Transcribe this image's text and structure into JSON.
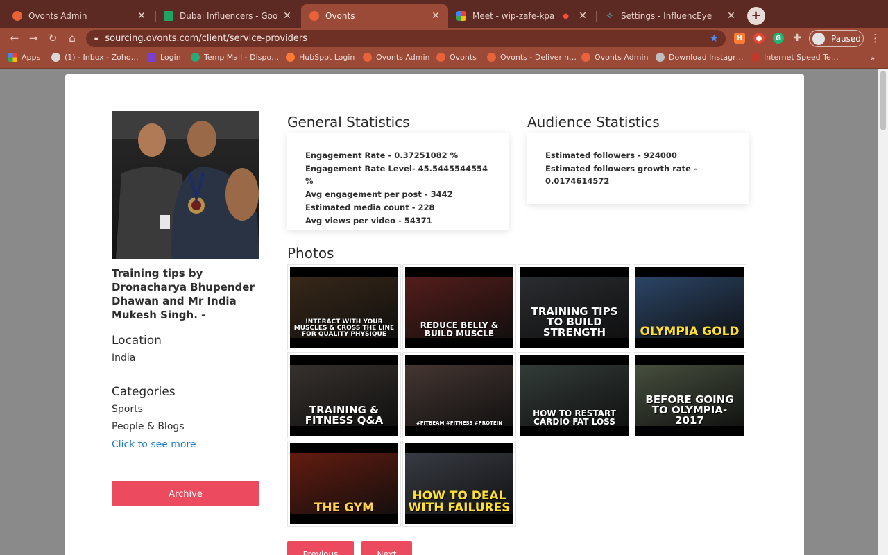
{
  "browser": {
    "tabs": [
      {
        "title": "Ovonts Admin",
        "active": false
      },
      {
        "title": "Dubai Influencers - Google Sh",
        "active": false
      },
      {
        "title": "Ovonts",
        "active": true
      },
      {
        "title": "Meet - wip-zafe-kpa",
        "active": false
      },
      {
        "title": "Settings - InfluencEye",
        "active": false
      }
    ],
    "new_tab": "+",
    "url": "sourcing.ovonts.com/client/service-providers",
    "profile_label": "Paused",
    "bookmarks": [
      "Apps",
      "(1) - Inbox - Zoho…",
      "Login",
      "Temp Mail - Dispo…",
      "HubSpot Login",
      "Ovonts Admin",
      "Ovonts",
      "Ovonts - Deliverin…",
      "Ovonts Admin",
      "Download Instagr…",
      "Internet Speed Te…"
    ],
    "bookmarks_more": "»"
  },
  "profile": {
    "name": "Training tips by Dronacharya Bhupender Dhawan and Mr India Mukesh Singh. -",
    "location_label": "Location",
    "location": "India",
    "categories_label": "Categories",
    "categories": [
      "Sports",
      "People & Blogs"
    ],
    "see_more": "Click to see more",
    "archive_label": "Archive"
  },
  "general_stats": {
    "title": "General Statistics",
    "lines": [
      "Engagement Rate - 0.37251082 %",
      "Engagement Rate Level- 45.5445544554 %",
      "Avg engagement per post - 3442",
      "Estimated media count - 228",
      "Avg views per video - 54371"
    ]
  },
  "audience_stats": {
    "title": "Audience Statistics",
    "lines": [
      "Estimated followers - 924000",
      "Estimated followers growth rate -",
      "0.0174614572"
    ]
  },
  "photos": {
    "title": "Photos",
    "items": [
      {
        "caption": "INTERACT WITH YOUR MUSCLES & CROSS THE LINE FOR QUALITY PHYSIQUE",
        "bg": "#3b2a1a"
      },
      {
        "caption": "REDUCE BELLY & BUILD MUSCLE",
        "bg": "#5a1f1c"
      },
      {
        "caption": "TRAINING TIPS TO BUILD STRENGTH",
        "bg": "#2d2f33"
      },
      {
        "caption": "OLYMPIA GOLD",
        "bg": "#2e4a6e"
      },
      {
        "caption": "TRAINING & FITNESS Q&A",
        "bg": "#3a3430"
      },
      {
        "caption": "#FITBEAM #FITNESS #PROTEIN",
        "bg": "#4a3a35"
      },
      {
        "caption": "HOW TO RESTART CARDIO FAT LOSS",
        "bg": "#36403c"
      },
      {
        "caption": "BEFORE GOING TO OLYMPIA-2017",
        "bg": "#4b5542"
      },
      {
        "caption": "THE GYM",
        "bg": "#6a1d10"
      },
      {
        "caption": "HOW TO DEAL WITH FAILURES",
        "bg": "#3c3f49"
      }
    ]
  },
  "pager": {
    "previous": "Previous",
    "next": "Next"
  },
  "colors": {
    "accent": "#ec4a5e",
    "link": "#1f7dc7",
    "chrome": "#9a4a37",
    "tabbar": "#5c2a22"
  }
}
